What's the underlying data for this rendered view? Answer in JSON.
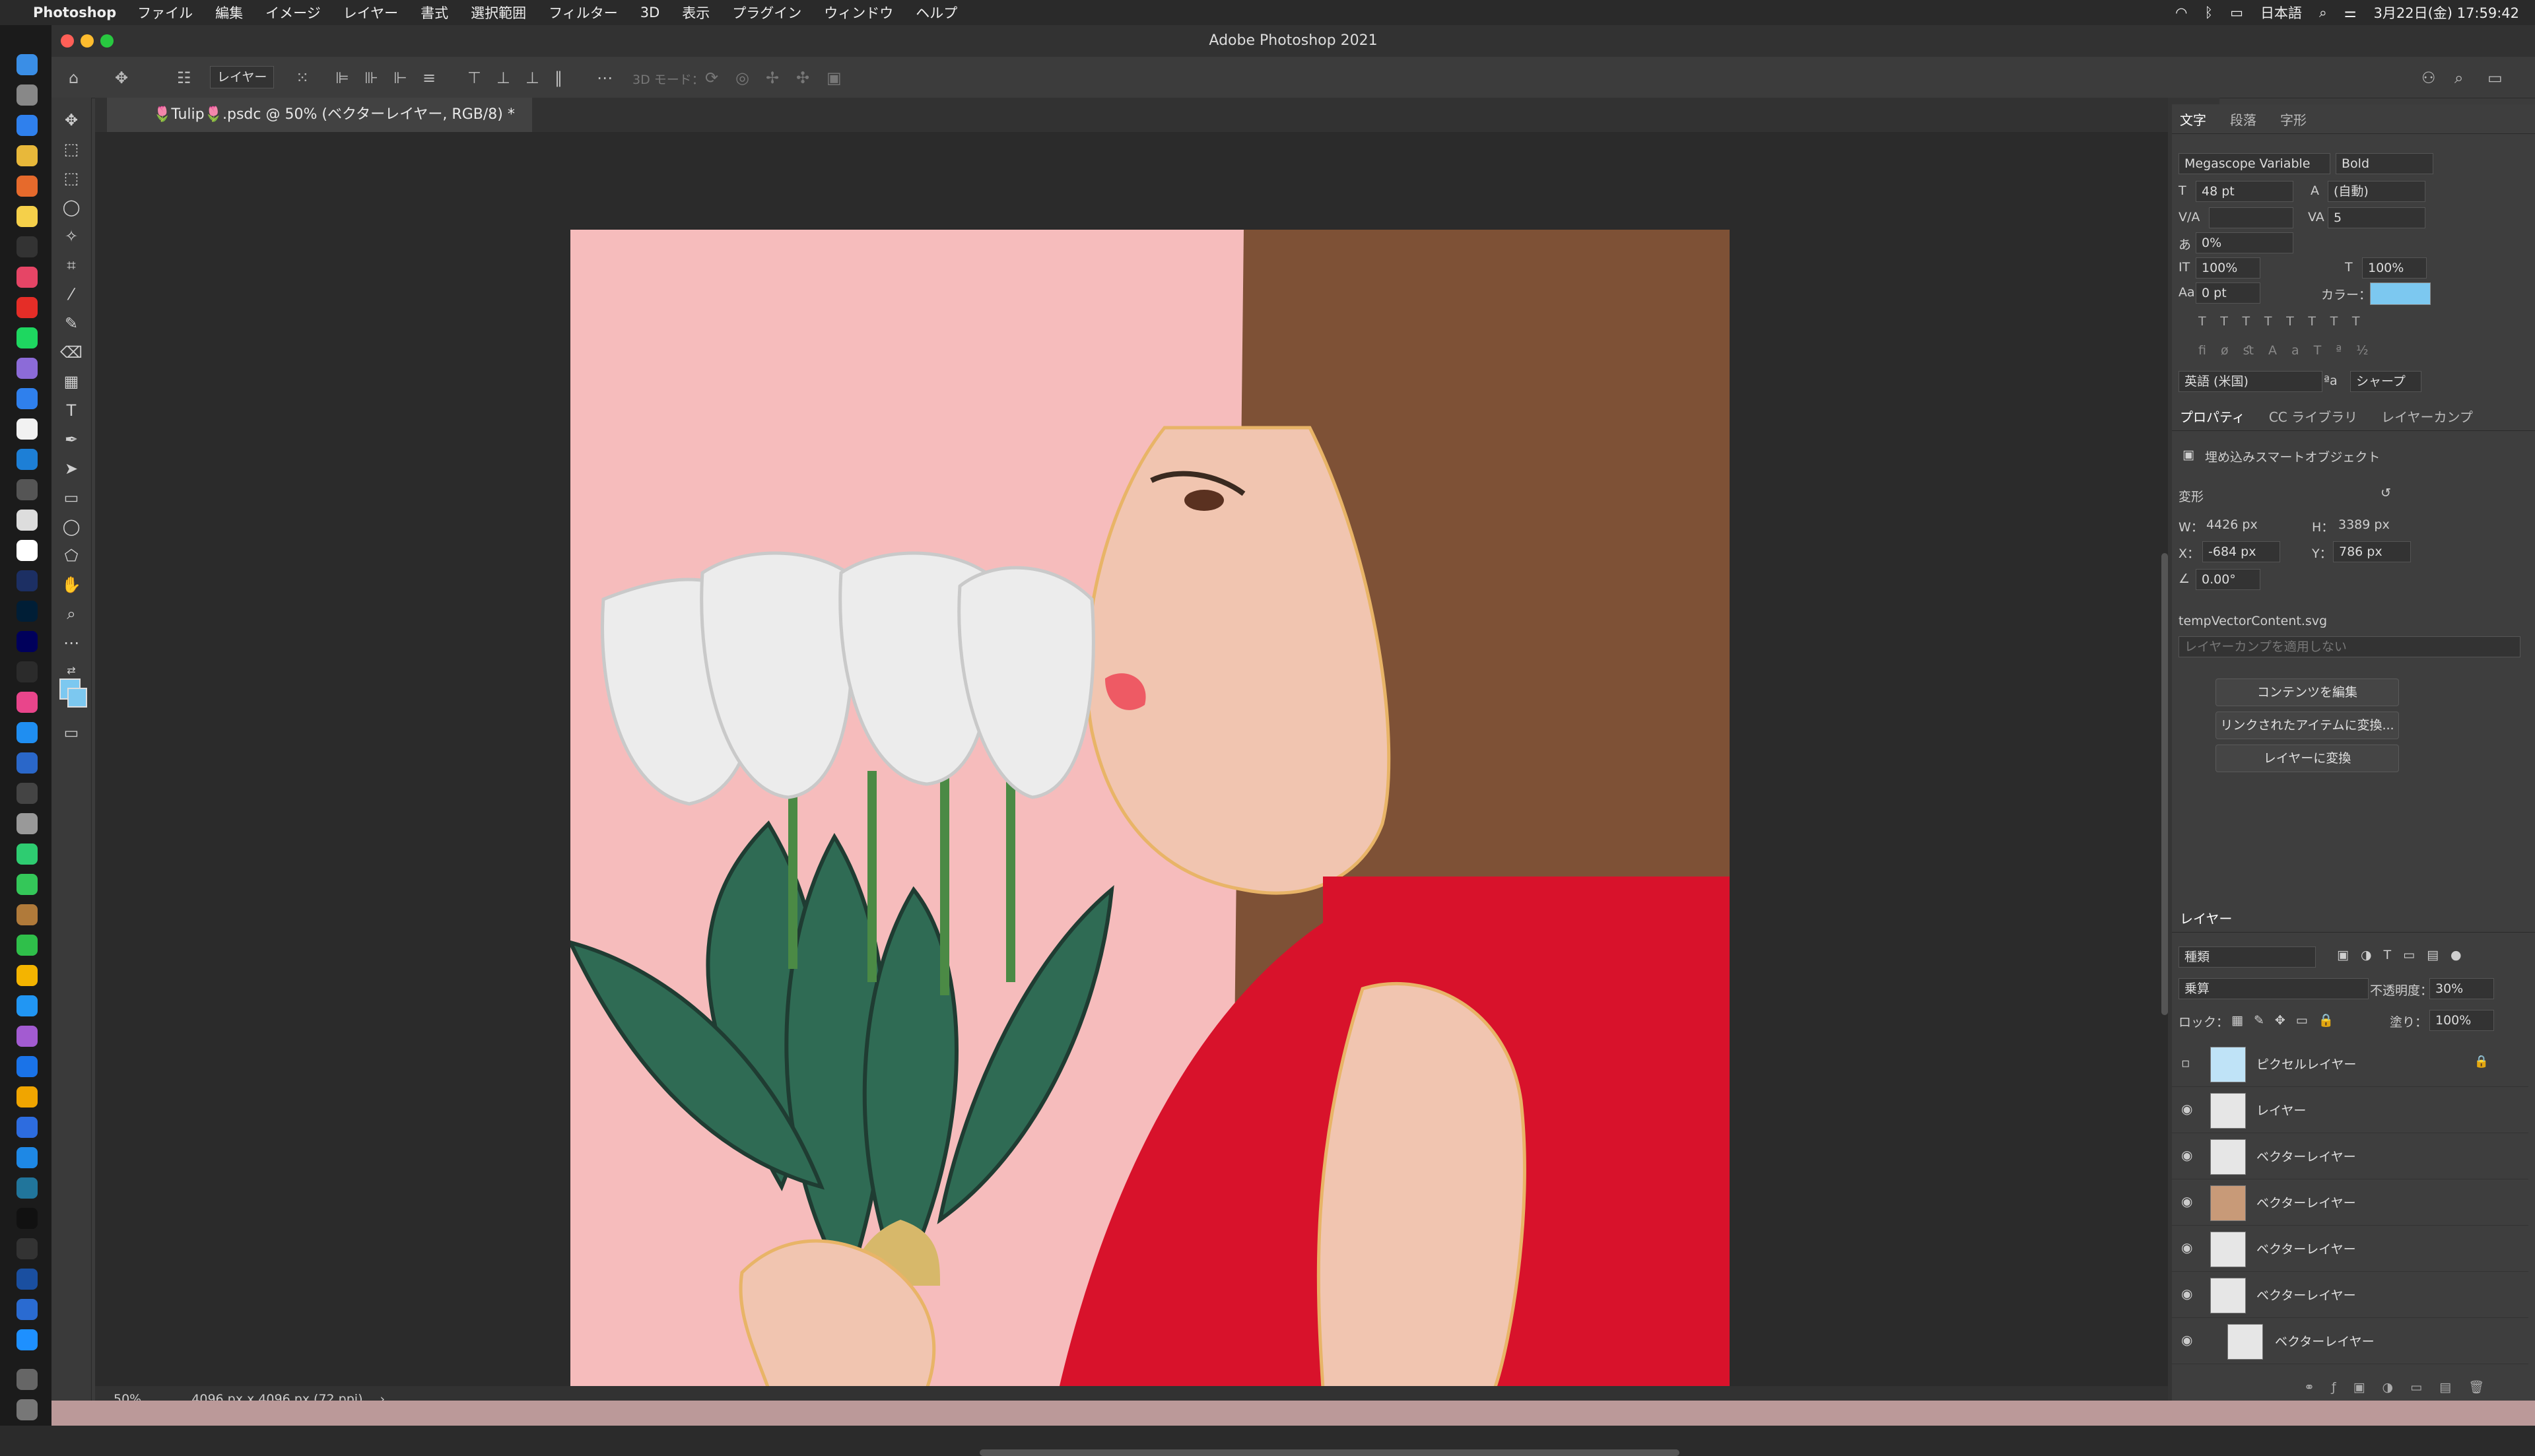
{
  "menubar": {
    "app_name": "Photoshop",
    "items": [
      "ファイル",
      "編集",
      "イメージ",
      "レイヤー",
      "書式",
      "選択範囲",
      "フィルター",
      "3D",
      "表示",
      "プラグイン",
      "ウィンドウ",
      "ヘルプ"
    ],
    "input_method": "日本語",
    "clock": "3月22日(金)  17:59:42"
  },
  "window": {
    "title": "Adobe Photoshop 2021"
  },
  "options_bar": {
    "target_select": "レイヤー",
    "mode_3d": "3D モード："
  },
  "document": {
    "tab_title": "🌷Tulip🌷.psdc @ 50% (ベクターレイヤー, RGB/8) *",
    "zoom": "50%",
    "size_info": "4096 px x 4096 px (72 ppi)"
  },
  "character_panel": {
    "tabs": [
      "文字",
      "段落",
      "字形"
    ],
    "font_family": "Megascope Variable",
    "font_style": "Bold",
    "font_size": "48 pt",
    "leading": "(自動)",
    "kerning": "",
    "tracking": "5",
    "tsume": "0%",
    "vertical_scale": "100%",
    "horizontal_scale": "100%",
    "baseline_shift": "0 pt",
    "color_label": "カラー：",
    "color_value": "#7cc8f0",
    "language": "英語 (米国)",
    "aa_label": "ªa",
    "antialias": "シャープ"
  },
  "properties_panel": {
    "tabs": [
      "プロパティ",
      "CC ライブラリ",
      "レイヤーカンプ"
    ],
    "object_type": "埋め込みスマートオブジェクト",
    "transform_label": "変形",
    "w_label": "W：",
    "w": "4426 px",
    "h_label": "H：",
    "h": "3389 px",
    "x_label": "X：",
    "x": "-684 px",
    "y_label": "Y：",
    "y": "786 px",
    "angle": "0.00°",
    "file_name": "tempVectorContent.svg",
    "comp_placeholder": "レイヤーカンプを適用しない",
    "edit_contents": "コンテンツを編集",
    "convert_linked": "リンクされたアイテムに変換...",
    "convert_layers": "レイヤーに変換"
  },
  "layers_panel": {
    "title": "レイヤー",
    "filter": "種類",
    "blend_mode": "乗算",
    "opacity_label": "不透明度：",
    "opacity": "30%",
    "lock_label": "ロック：",
    "fill_label": "塗り：",
    "fill": "100%",
    "layers": [
      {
        "name": "ピクセルレイヤー",
        "visible": false,
        "locked": true
      },
      {
        "name": "レイヤー",
        "visible": true,
        "locked": false
      },
      {
        "name": "ベクターレイヤー",
        "visible": true,
        "locked": false
      },
      {
        "name": "ベクターレイヤー",
        "visible": true,
        "locked": false
      },
      {
        "name": "ベクターレイヤー",
        "visible": true,
        "locked": false
      },
      {
        "name": "ベクターレイヤー",
        "visible": true,
        "locked": false
      },
      {
        "name": "ベクターレイヤー",
        "visible": true,
        "locked": false
      }
    ]
  },
  "colors": {
    "accent": "#7cc8f0",
    "canvas_bg": "#f6bcbc"
  }
}
